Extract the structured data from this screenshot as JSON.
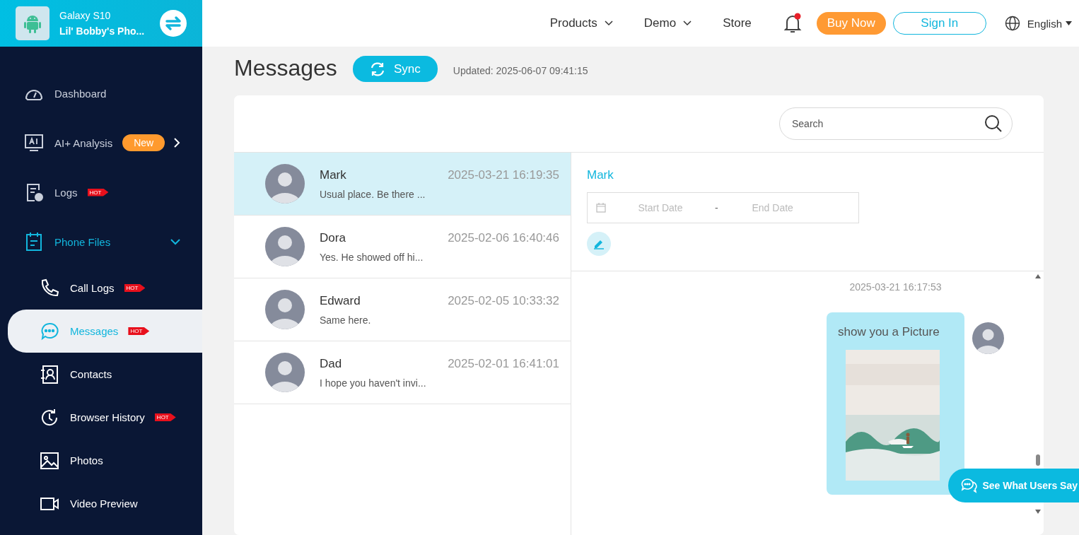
{
  "device": {
    "model": "Galaxy S10",
    "name": "Lil' Bobby's Pho..."
  },
  "sidebar": {
    "items": [
      {
        "label": "Dashboard"
      },
      {
        "label": "AI+ Analysis",
        "badge": {
          "kind": "new",
          "text": "New"
        },
        "expanded": false
      },
      {
        "label": "Logs",
        "badge": {
          "kind": "hot",
          "text": "HOT"
        }
      },
      {
        "label": "Phone Files",
        "expanded": true,
        "children": [
          {
            "label": "Call Logs",
            "badge": {
              "kind": "hot",
              "text": "HOT"
            },
            "selected": false
          },
          {
            "label": "Messages",
            "badge": {
              "kind": "hot",
              "text": "HOT"
            },
            "selected": true
          },
          {
            "label": "Contacts",
            "selected": false
          },
          {
            "label": "Browser History",
            "badge": {
              "kind": "hot",
              "text": "HOT"
            },
            "selected": false
          },
          {
            "label": "Photos",
            "selected": false
          },
          {
            "label": "Video Preview",
            "selected": false
          }
        ]
      }
    ]
  },
  "nav": [
    {
      "label": "Products",
      "dropdown": true
    },
    {
      "label": "Demo",
      "dropdown": true
    },
    {
      "label": "Store",
      "dropdown": false
    }
  ],
  "notifications": {
    "unread": true
  },
  "buttons": [
    {
      "label": "Buy Now",
      "kind": "filled"
    },
    {
      "label": "Sign In",
      "kind": "outline"
    }
  ],
  "language": "English",
  "page": {
    "title": "Messages",
    "sync": "Sync",
    "updated": "Updated: 2025-06-07 09:41:15"
  },
  "search": {
    "placeholder": "Search"
  },
  "conversations": [
    {
      "name": "Mark",
      "time": "2025-03-21 16:19:35",
      "preview": "Usual place. Be there ...",
      "selected": true
    },
    {
      "name": "Dora",
      "time": "2025-02-06 16:40:46",
      "preview": "Yes. He showed off hi...",
      "selected": false
    },
    {
      "name": "Edward",
      "time": "2025-02-05 10:33:32",
      "preview": "Same here.",
      "selected": false
    },
    {
      "name": "Dad",
      "time": "2025-02-01 16:41:01",
      "preview": "I hope you haven't invi...",
      "selected": false
    }
  ],
  "detail": {
    "contact": "Mark",
    "start_placeholder": "Start Date",
    "separator": "-",
    "end_placeholder": "End Date"
  },
  "messages": [
    {
      "time": "2025-03-21 16:17:53",
      "text": "show you a Picture",
      "kind": "picture"
    }
  ],
  "feedback_button": "See What Users Say"
}
